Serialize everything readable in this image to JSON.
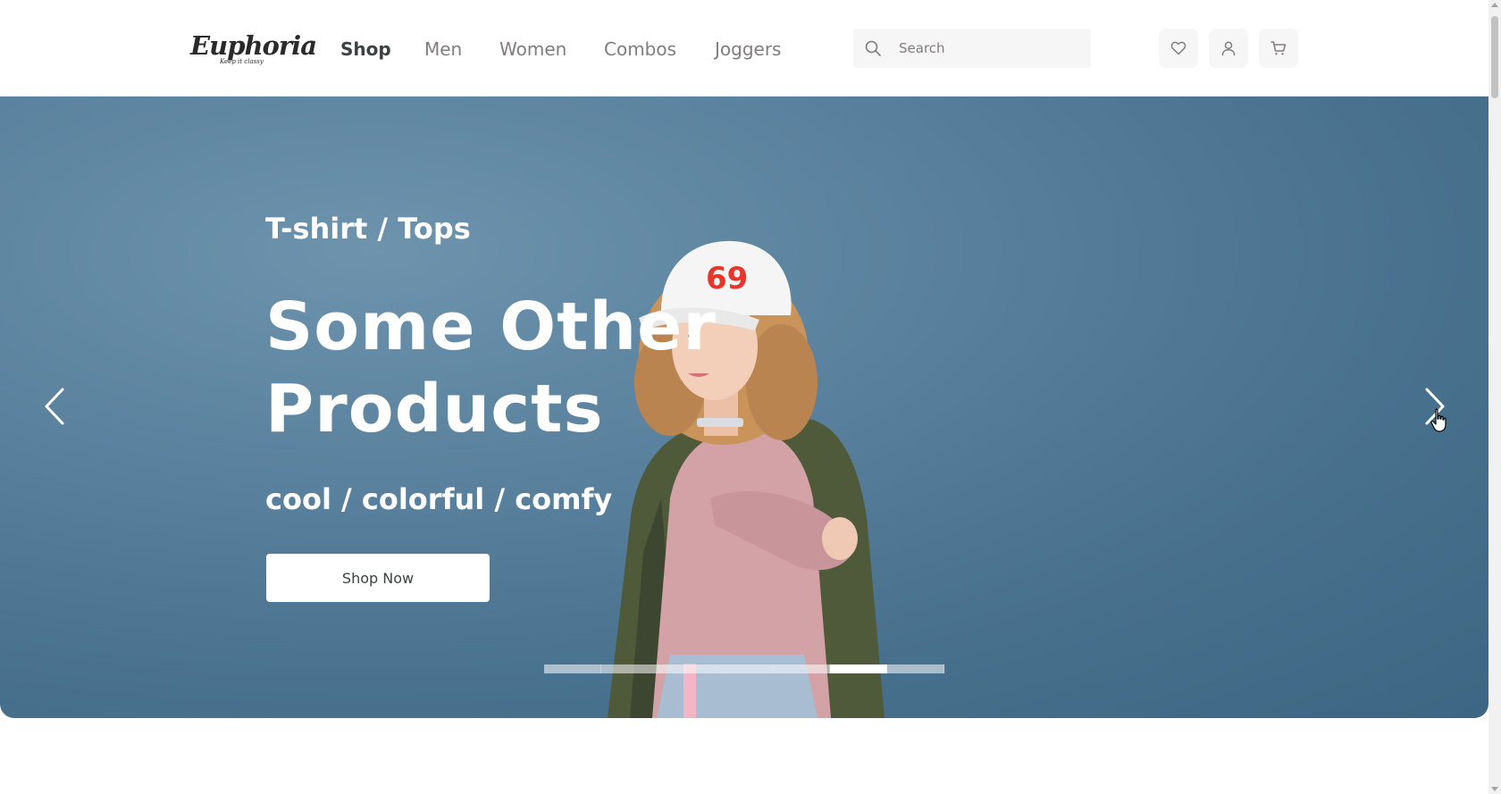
{
  "brand": {
    "name": "Euphoria",
    "tagline": "Keep it classy"
  },
  "nav": {
    "items": [
      {
        "label": "Shop",
        "active": true
      },
      {
        "label": "Men",
        "active": false
      },
      {
        "label": "Women",
        "active": false
      },
      {
        "label": "Combos",
        "active": false
      },
      {
        "label": "Joggers",
        "active": false
      }
    ]
  },
  "search": {
    "placeholder": "Search",
    "value": "",
    "icon": "search-icon"
  },
  "header_icons": [
    "heart-icon",
    "user-icon",
    "cart-icon"
  ],
  "hero": {
    "category": "T-shirt / Tops",
    "headline_line1": "Some Other",
    "headline_line2": "Products",
    "tagline": "cool / colorful / comfy",
    "cta_label": "Shop Now",
    "prev_icon": "chevron-left-icon",
    "next_icon": "chevron-right-icon",
    "slides_total": 7,
    "active_slide": 6,
    "image_subject": "woman-in-cap-and-jacket"
  },
  "colors": {
    "hero_bg": "#5a819d",
    "text_primary": "#3c4242",
    "text_muted": "#807d7e",
    "input_bg": "#f6f6f6"
  }
}
